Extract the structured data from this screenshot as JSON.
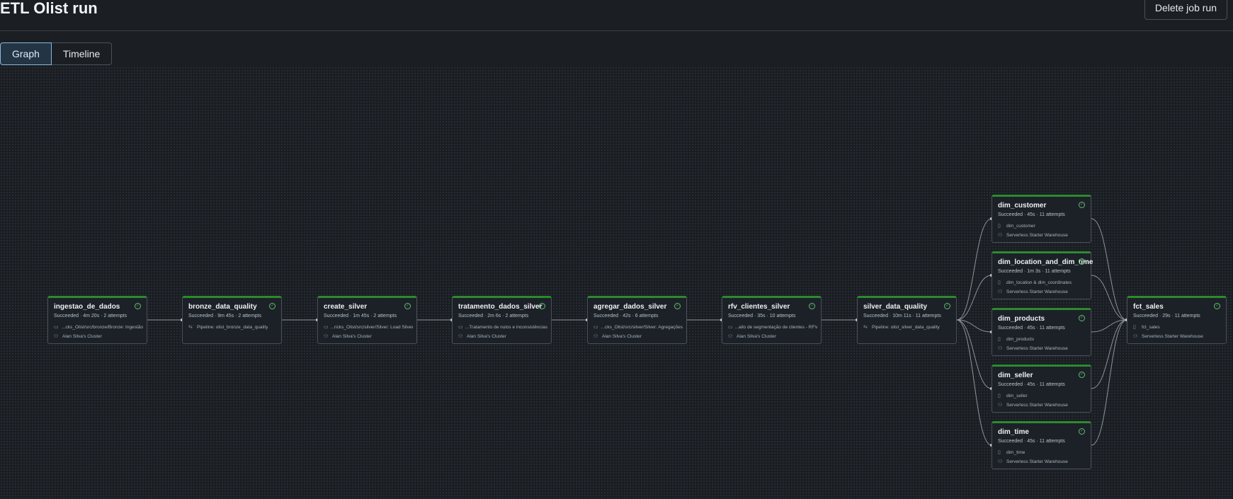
{
  "header": {
    "title": "ETL Olist run",
    "delete_label": "Delete job run"
  },
  "tabs": [
    "Graph",
    "Timeline"
  ],
  "colors": {
    "success_accent": "#2d8a2d",
    "active_tab": "#233445"
  },
  "nodes": [
    {
      "title": "ingestao_de_dados",
      "status": "Succeeded · 4m 20s · 2 attempts",
      "line1_icon": "folder-icon",
      "line1": "...cks_Olist/src/bronze/Bronze: Ingestão",
      "line2_icon": "cluster-icon",
      "line2": "Alan Silva's Cluster"
    },
    {
      "title": "bronze_data_quality",
      "status": "Succeeded · 9m 45s · 2 attempts",
      "line1_icon": "pipeline-icon",
      "line1": "Pipeline:  olist_bronze_data_quality",
      "line2_icon": "",
      "line2": ""
    },
    {
      "title": "create_silver",
      "status": "Succeeded · 1m 45s · 2 attempts",
      "line1_icon": "folder-icon",
      "line1": "...ricks_Olist/src/silver/Silver: Load Silver",
      "line2_icon": "cluster-icon",
      "line2": "Alan Silva's Cluster"
    },
    {
      "title": "tratamento_dados_silver",
      "status": "Succeeded · 2m 6s · 2 attempts",
      "line1_icon": "folder-icon",
      "line1": "...Tratamento de nulos e inconsistências",
      "line2_icon": "cluster-icon",
      "line2": "Alan Silva's Cluster"
    },
    {
      "title": "agregar_dados_silver",
      "status": "Succeeded · 42s · 6 attempts",
      "line1_icon": "folder-icon",
      "line1": "...cks_Olist/src/silver/Silver: Agregações",
      "line2_icon": "cluster-icon",
      "line2": "Alan Silva's Cluster"
    },
    {
      "title": "rfv_clientes_silver",
      "status": "Succeeded · 35s · 10 attempts",
      "line1_icon": "folder-icon",
      "line1": "...ailo de segmentação de clientes - RFV",
      "line2_icon": "cluster-icon",
      "line2": "Alan Silva's Cluster"
    },
    {
      "title": "silver_data_quality",
      "status": "Succeeded · 10m 11s · 11 attempts",
      "line1_icon": "pipeline-icon",
      "line1": "Pipeline:  olist_silver_data_quality",
      "line2_icon": "",
      "line2": ""
    },
    {
      "title": "dim_customer",
      "status": "Succeeded · 45s · 11 attempts",
      "line1_icon": "file-icon",
      "line1": "dim_customer",
      "line2_icon": "warehouse-icon",
      "line2": "Serverless Starter Warehouse"
    },
    {
      "title": "dim_location_and_dim_time",
      "status": "Succeeded · 1m 3s · 11 attempts",
      "line1_icon": "file-icon",
      "line1": "dim_location & dim_coordinates",
      "line2_icon": "warehouse-icon",
      "line2": "Serverless Starter Warehouse"
    },
    {
      "title": "dim_products",
      "status": "Succeeded · 45s · 11 attempts",
      "line1_icon": "file-icon",
      "line1": "dim_products",
      "line2_icon": "warehouse-icon",
      "line2": "Serverless Starter Warehouse"
    },
    {
      "title": "dim_seller",
      "status": "Succeeded · 45s · 11 attempts",
      "line1_icon": "file-icon",
      "line1": "dim_seller",
      "line2_icon": "warehouse-icon",
      "line2": "Serverless Starter Warehouse"
    },
    {
      "title": "dim_time",
      "status": "Succeeded · 45s · 11 attempts",
      "line1_icon": "file-icon",
      "line1": "dim_time",
      "line2_icon": "warehouse-icon",
      "line2": "Serverless Starter Warehouse"
    },
    {
      "title": "fct_sales",
      "status": "Succeeded · 29s · 11 attempts",
      "line1_icon": "file-icon",
      "line1": "fct_sales",
      "line2_icon": "warehouse-icon",
      "line2": "Serverless Starter Warehouse"
    }
  ]
}
